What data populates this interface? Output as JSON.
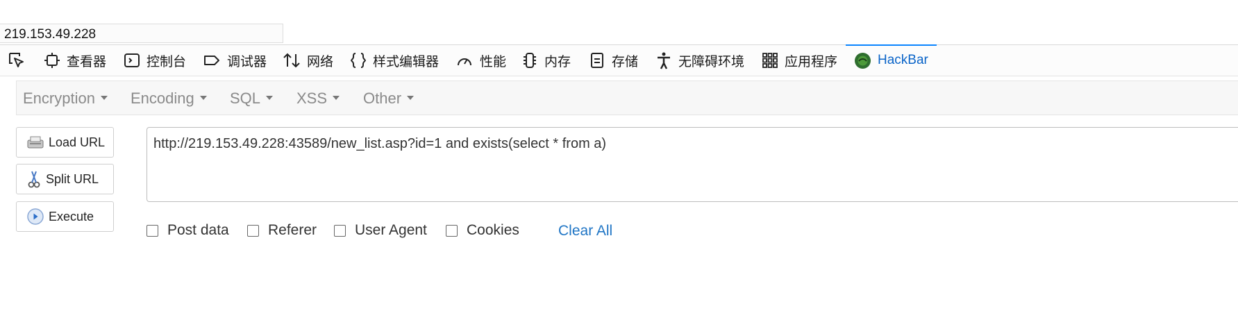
{
  "address": "219.153.49.228",
  "devtools": {
    "tabs": [
      {
        "label": "查看器",
        "icon": "inspector-icon"
      },
      {
        "label": "控制台",
        "icon": "console-icon"
      },
      {
        "label": "调试器",
        "icon": "debugger-icon"
      },
      {
        "label": "网络",
        "icon": "network-icon"
      },
      {
        "label": "样式编辑器",
        "icon": "style-editor-icon"
      },
      {
        "label": "性能",
        "icon": "performance-icon"
      },
      {
        "label": "内存",
        "icon": "memory-icon"
      },
      {
        "label": "存储",
        "icon": "storage-icon"
      },
      {
        "label": "无障碍环境",
        "icon": "accessibility-icon"
      },
      {
        "label": "应用程序",
        "icon": "application-icon"
      },
      {
        "label": "HackBar",
        "icon": "hackbar-icon",
        "active": true
      }
    ]
  },
  "hackbar": {
    "menus": [
      "Encryption",
      "Encoding",
      "SQL",
      "XSS",
      "Other"
    ],
    "buttons": {
      "load": "Load URL",
      "split": "Split URL",
      "execute": "Execute"
    },
    "url": "http://219.153.49.228:43589/new_list.asp?id=1 and exists(select * from a)",
    "options": [
      "Post data",
      "Referer",
      "User Agent",
      "Cookies"
    ],
    "clear_all": "Clear All"
  },
  "colors": {
    "accent": "#0a84ff",
    "link": "#1f75c5",
    "menu_text": "#8a8a8a"
  }
}
